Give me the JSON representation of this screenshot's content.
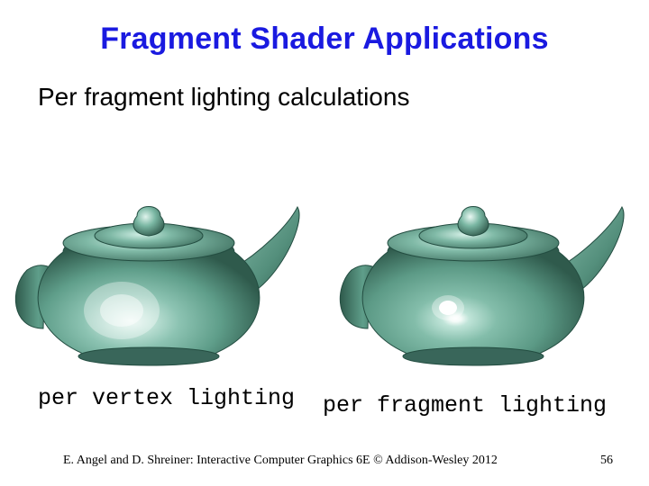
{
  "title": "Fragment Shader Applications",
  "subtitle": "Per fragment lighting calculations",
  "captions": {
    "left": "per vertex lighting",
    "right": "per fragment lighting"
  },
  "footer": {
    "text": "E. Angel and D. Shreiner: Interactive Computer Graphics 6E © Addison-Wesley 2012",
    "page": "56"
  },
  "teapot": {
    "body_color": "#6aa994",
    "body_color_dark": "#3b6f5e",
    "body_color_light": "#c9ebe0",
    "highlight_color": "#ffffff"
  }
}
